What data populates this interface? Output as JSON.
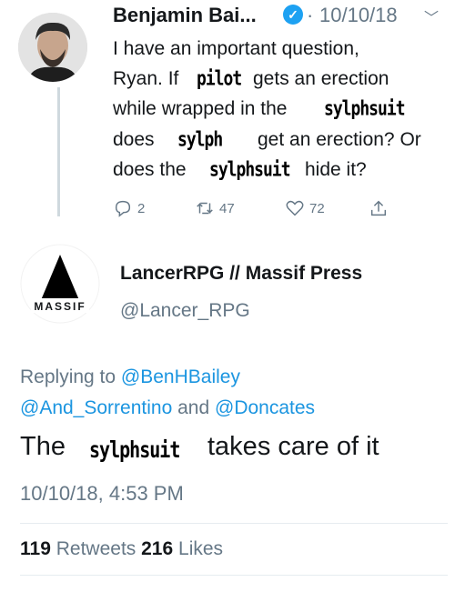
{
  "tweet1": {
    "author": "Benjamin Bai...",
    "separator": "·",
    "date": "10/10/18",
    "lines": [
      "I have an important question,",
      "Ryan. If",
      "gets an erection",
      "while wrapped in the",
      "does",
      "get an erection? Or",
      "does the",
      "hide it?"
    ],
    "meme_words": [
      "pilot",
      "sylphsuit",
      "sylph",
      "sylphsuit"
    ],
    "actions": {
      "replies": "2",
      "retweets": "47",
      "likes": "72"
    }
  },
  "tweet2": {
    "author": "LancerRPG // Massif Press",
    "handle": "@Lancer_RPG",
    "avatar_text": "MASSIF",
    "replying_prefix": "Replying to",
    "mentions": [
      "@BenHBailey",
      "@And_Sorrentino",
      "@Doncates"
    ],
    "and_word": "and",
    "reply_before": "The",
    "reply_meme_word": "sylphsuit",
    "reply_after": "takes care of it",
    "date": "10/10/18, 4:53 PM",
    "retweets_count": "119",
    "retweets_label": "Retweets",
    "likes_count": "216",
    "likes_label": "Likes"
  },
  "icons": [
    "verified-badge-icon",
    "chevron-down-icon",
    "reply-icon",
    "retweet-icon",
    "heart-icon",
    "share-icon"
  ],
  "colors": {
    "link": "#1b95e0",
    "muted": "#657786",
    "verified": "#1da1f2"
  }
}
